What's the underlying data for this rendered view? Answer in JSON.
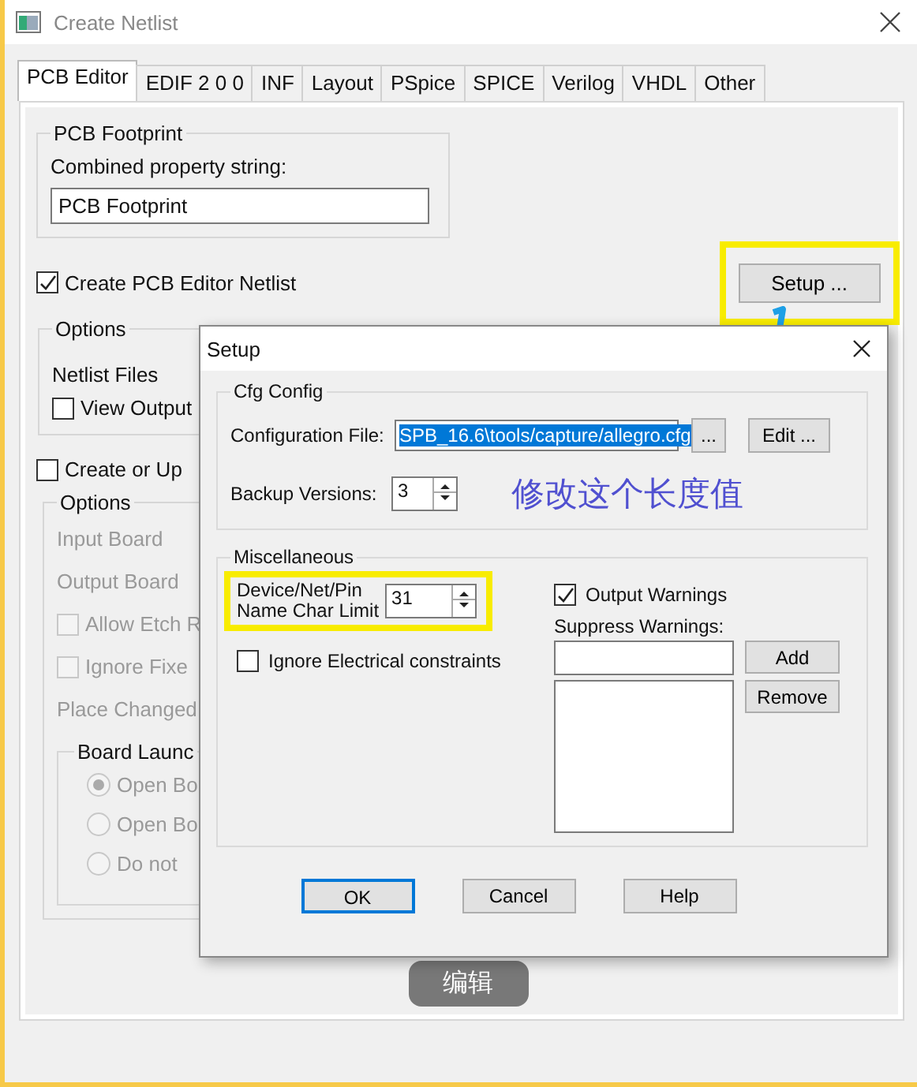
{
  "window": {
    "title": "Create Netlist"
  },
  "tabs": [
    {
      "label": "PCB Editor",
      "selected": true
    },
    {
      "label": "EDIF 2 0 0",
      "selected": false
    },
    {
      "label": "INF",
      "selected": false
    },
    {
      "label": "Layout",
      "selected": false
    },
    {
      "label": "PSpice",
      "selected": false
    },
    {
      "label": "SPICE",
      "selected": false
    },
    {
      "label": "Verilog",
      "selected": false
    },
    {
      "label": "VHDL",
      "selected": false
    },
    {
      "label": "Other",
      "selected": false
    }
  ],
  "pcb_footprint": {
    "title": "PCB Footprint",
    "label": "Combined property string:",
    "value": "PCB Footprint"
  },
  "create_netlist": {
    "label": "Create PCB Editor Netlist",
    "checked": true
  },
  "setup_button": {
    "label": "Setup ...",
    "highlighted": true
  },
  "options": {
    "title": "Options",
    "netlist_files": "Netlist Files",
    "view_output": {
      "label": "View Output",
      "checked": false
    }
  },
  "create_or_update": {
    "label": "Create or Up",
    "checked": false
  },
  "options_2": {
    "title": "Options",
    "items": [
      {
        "kind": "text",
        "label": "Input Board",
        "disabled": true
      },
      {
        "kind": "text",
        "label": "Output Board",
        "disabled": true
      },
      {
        "kind": "checkbox",
        "label": "Allow Etch R",
        "checked": false,
        "disabled": true
      },
      {
        "kind": "checkbox",
        "label": "Ignore Fixe",
        "checked": false,
        "disabled": true
      },
      {
        "kind": "text",
        "label": "Place Changed",
        "disabled": true
      }
    ],
    "board_launch": {
      "title": "Board Launc",
      "options": [
        {
          "label": "Open Bo",
          "selected": true,
          "disabled": true
        },
        {
          "label": "Open Bo",
          "selected": false,
          "disabled": true
        },
        {
          "label": "Do not",
          "selected": false,
          "disabled": true
        }
      ]
    }
  },
  "edit_badge": {
    "label": "编辑"
  },
  "setup_dialog": {
    "title": "Setup",
    "cfg_config": {
      "title": "Cfg Config",
      "config_file_label": "Configuration File:",
      "config_file_value": "SPB_16.6\\tools/capture/allegro.cfg",
      "browse_button": "...",
      "edit_button": "Edit ...",
      "backup_label": "Backup Versions:",
      "backup_value": "3"
    },
    "annotation": "修改这个长度值",
    "misc": {
      "title": "Miscellaneous",
      "limit_label_1": "Device/Net/Pin",
      "limit_label_2": "Name Char Limit",
      "limit_value": "31",
      "limit_highlighted": true,
      "ignore_electrical": {
        "label": "Ignore Electrical constraints",
        "checked": false
      },
      "output_warnings": {
        "label": "Output Warnings",
        "checked": true
      },
      "suppress_label": "Suppress Warnings:",
      "add_button": "Add",
      "remove_button": "Remove"
    },
    "buttons": [
      {
        "label": "OK",
        "focused": true
      },
      {
        "label": "Cancel",
        "focused": false
      },
      {
        "label": "Help",
        "focused": false
      }
    ]
  }
}
